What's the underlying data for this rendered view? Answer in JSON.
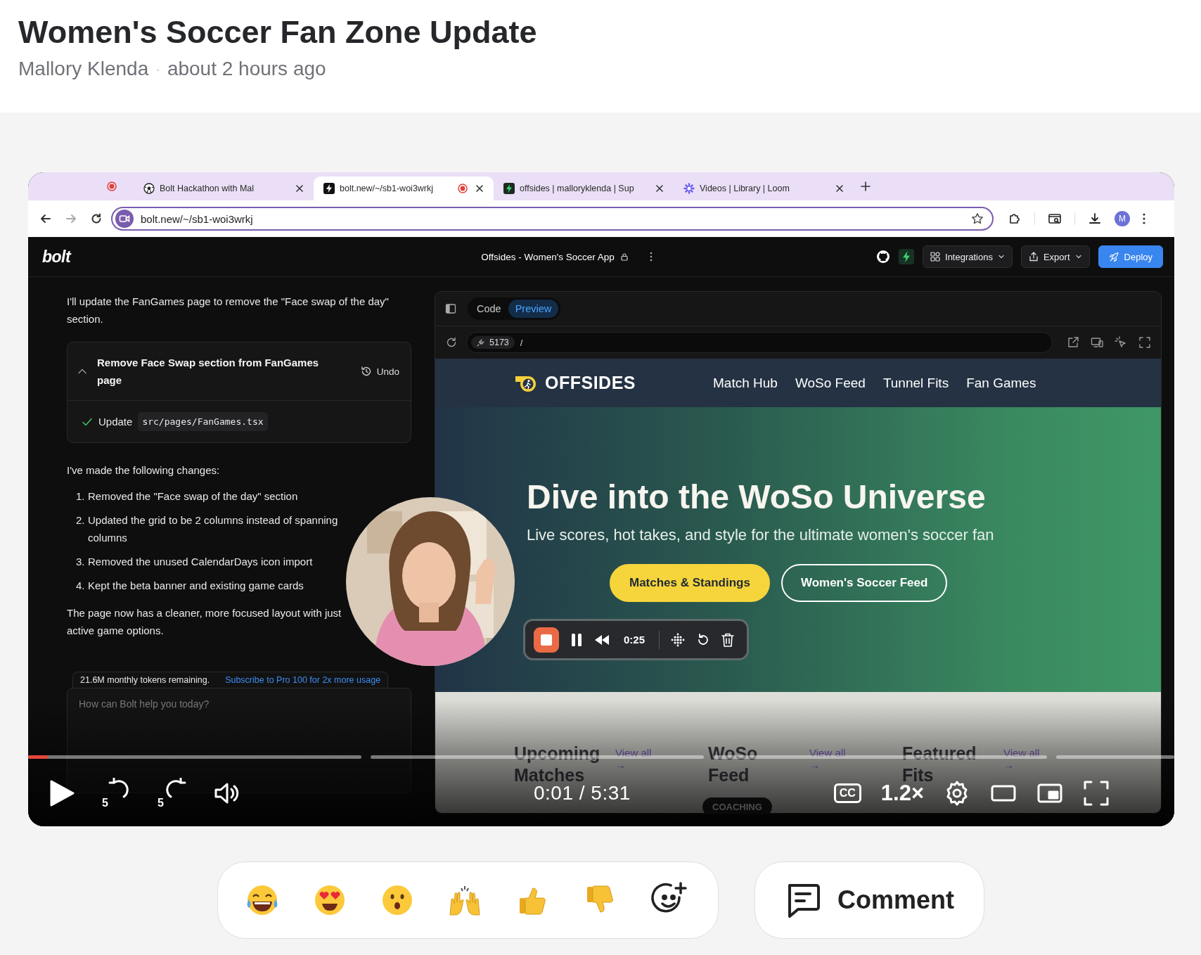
{
  "post": {
    "title": "Women's Soccer Fan Zone Update",
    "author": "Mallory Klenda",
    "separator": "·",
    "time": "about 2 hours ago"
  },
  "video": {
    "browser": {
      "recording_indicator": true,
      "tabs": [
        {
          "label": "Bolt Hackathon with Mal",
          "selected": false,
          "recording": false
        },
        {
          "label": "bolt.new/~/sb1-woi3wrkj",
          "selected": true,
          "recording": true
        },
        {
          "label": "offsides | malloryklenda | Sup",
          "selected": false,
          "recording": false
        },
        {
          "label": "Videos | Library | Loom",
          "selected": false,
          "recording": false
        }
      ],
      "address": "bolt.new/~/sb1-woi3wrkj",
      "profile": "M"
    },
    "bolt": {
      "logo": "bolt",
      "project": "Offsides - Women's Soccer App",
      "integrations": "Integrations",
      "export": "Export",
      "deploy": "Deploy",
      "chat": {
        "intro": [
          "I'll update the FanGames page to remove the \"Face swap of the day\"",
          "section."
        ],
        "action": {
          "title": [
            "Remove Face Swap section from FanGames",
            "page"
          ],
          "undo": "Undo",
          "expanded": true,
          "steps": [
            {
              "verb": "Update",
              "file": "src/pages/FanGames.tsx",
              "done": true
            }
          ]
        },
        "summary": "I've made the following changes:",
        "changes": [
          {
            "number": "1.",
            "lines": [
              "Removed the \"Face swap of the day\" section"
            ]
          },
          {
            "number": "2.",
            "lines": [
              "Updated the grid to be 2 columns instead of spanning",
              "columns"
            ]
          },
          {
            "number": "3.",
            "lines": [
              "Removed the unused CalendarDays icon import"
            ]
          },
          {
            "number": "4.",
            "lines": [
              "Kept the beta banner and existing game cards"
            ]
          }
        ],
        "closing": [
          "The page now has a cleaner, more focused layout with just",
          "active game options."
        ],
        "tokens": "21.6M monthly tokens remaining.",
        "subscribe": "Subscribe to Pro 100 for 2x more usage",
        "placeholder": "How can Bolt help you today?"
      },
      "preview": {
        "tabs": [
          {
            "label": "Code",
            "selected": false
          },
          {
            "label": "Preview",
            "selected": true
          }
        ],
        "port": "5173",
        "path": "/",
        "site": {
          "brand": "OFFSIDES",
          "nav": [
            "Match Hub",
            "WoSo Feed",
            "Tunnel Fits",
            "Fan Games"
          ],
          "headline": "Dive into the WoSo Universe",
          "subline": "Live scores, hot takes, and style for the ultimate women's soccer fan",
          "buttons": [
            {
              "label": "Matches & Standings",
              "kind": "primary"
            },
            {
              "label": "Women's Soccer Feed",
              "kind": "outline"
            }
          ],
          "sections": [
            {
              "title": "Upcoming Matches",
              "link": "View all →"
            },
            {
              "title": "WoSo Feed",
              "link": "View all →"
            },
            {
              "title": "Featured Fits",
              "link": "View all →"
            }
          ],
          "tag": "COACHING"
        }
      }
    },
    "recorder": {
      "time": "0:25",
      "paused": false
    },
    "player": {
      "progress": {
        "level": 0.017
      },
      "playing": false,
      "skip_back": "5",
      "skip_forward": "5",
      "time": "0:01 / 5:31",
      "captions": "CC",
      "speed": "1.2×"
    }
  },
  "comment_button": "Comment"
}
